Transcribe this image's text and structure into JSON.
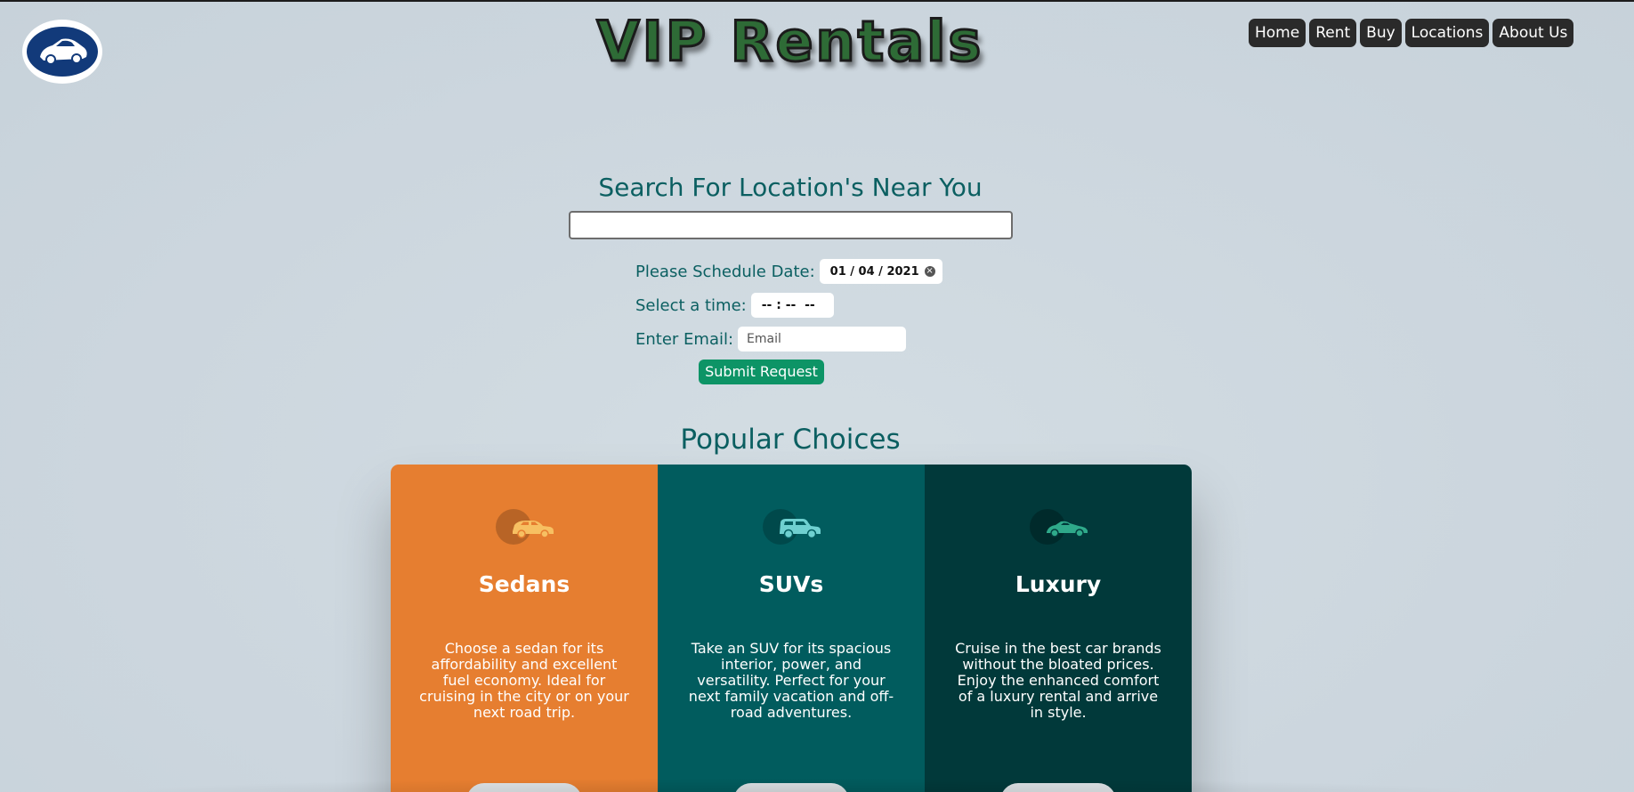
{
  "brand": {
    "title": "VIP Rentals",
    "logo_icon": "car-icon"
  },
  "nav": {
    "items": [
      "Home",
      "Rent",
      "Buy",
      "Locations",
      "About Us"
    ]
  },
  "search": {
    "heading": "Search For Location's Near You",
    "value": "",
    "placeholder": ""
  },
  "form": {
    "date_label": "Please Schedule Date:",
    "date_value": "01 / 04 / 2021",
    "time_label": "Select a time:",
    "time_value": "-- : --  --",
    "email_label": "Enter Email:",
    "email_placeholder": "Email",
    "submit_label": "Submit Request"
  },
  "popular": {
    "heading": "Popular Choices",
    "cards": [
      {
        "title": "Sedans",
        "description": "Choose a sedan for its affordability and excellent fuel economy. Ideal for cruising in the city or on your next road trip.",
        "icon": "sedan-icon",
        "color": "#e67e30",
        "icon_color": "#f7c062"
      },
      {
        "title": "SUVs",
        "description": "Take an SUV for its spacious interior, power, and versatility. Perfect for your next family vacation and off-road adventures.",
        "icon": "suv-icon",
        "color": "#015c5e",
        "icon_color": "#6fd0d0"
      },
      {
        "title": "Luxury",
        "description": "Cruise in the best car brands without the bloated prices. Enjoy the enhanced comfort of a luxury rental and arrive in style.",
        "icon": "luxury-car-icon",
        "color": "#01393a",
        "icon_color": "#2fa98a"
      }
    ]
  },
  "colors": {
    "accent": "#0b5f61",
    "submit": "#0d9466",
    "nav_bg": "#2a2a2a"
  }
}
